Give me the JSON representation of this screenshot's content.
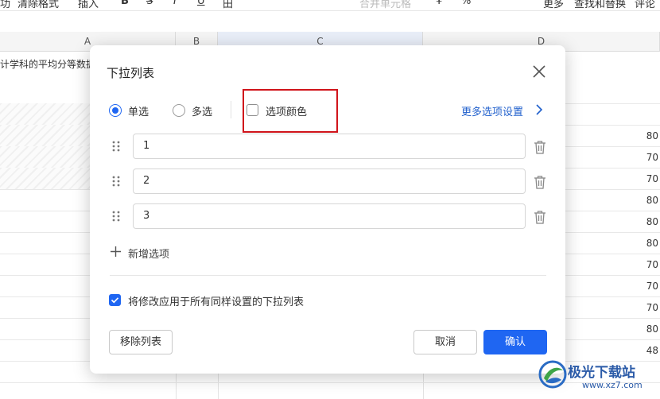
{
  "toolbar": {
    "items": [
      "功",
      "清除格式",
      "插入",
      "B",
      "S",
      "I",
      "U",
      "田",
      "合并单元格",
      "¥",
      "%",
      "更多",
      "查找和替换",
      "评论"
    ]
  },
  "sheet": {
    "columns": [
      "A",
      "B",
      "C",
      "D"
    ],
    "selected_column": "C",
    "a1_text": "计学科的平均分等数据",
    "d_values": [
      "80",
      "70",
      "70",
      "80",
      "80",
      "80",
      "70",
      "70",
      "70",
      "80",
      "48"
    ]
  },
  "dialog": {
    "title": "下拉列表",
    "mode_single": "单选",
    "mode_multi": "多选",
    "option_color": "选项颜色",
    "more_settings": "更多选项设置",
    "options": [
      "1",
      "2",
      "3"
    ],
    "add_option": "新增选项",
    "apply_all": "将修改应用于所有同样设置的下拉列表",
    "remove_button": "移除列表",
    "cancel_button": "取消",
    "ok_button": "确认",
    "single_selected": true,
    "option_color_checked": false,
    "apply_all_checked": true
  },
  "colors": {
    "accent": "#1f66f2",
    "highlight_box": "#d0141b",
    "link": "#1f5fcc"
  },
  "watermark": {
    "name": "极光下载站",
    "url": "www.xz7.com"
  }
}
